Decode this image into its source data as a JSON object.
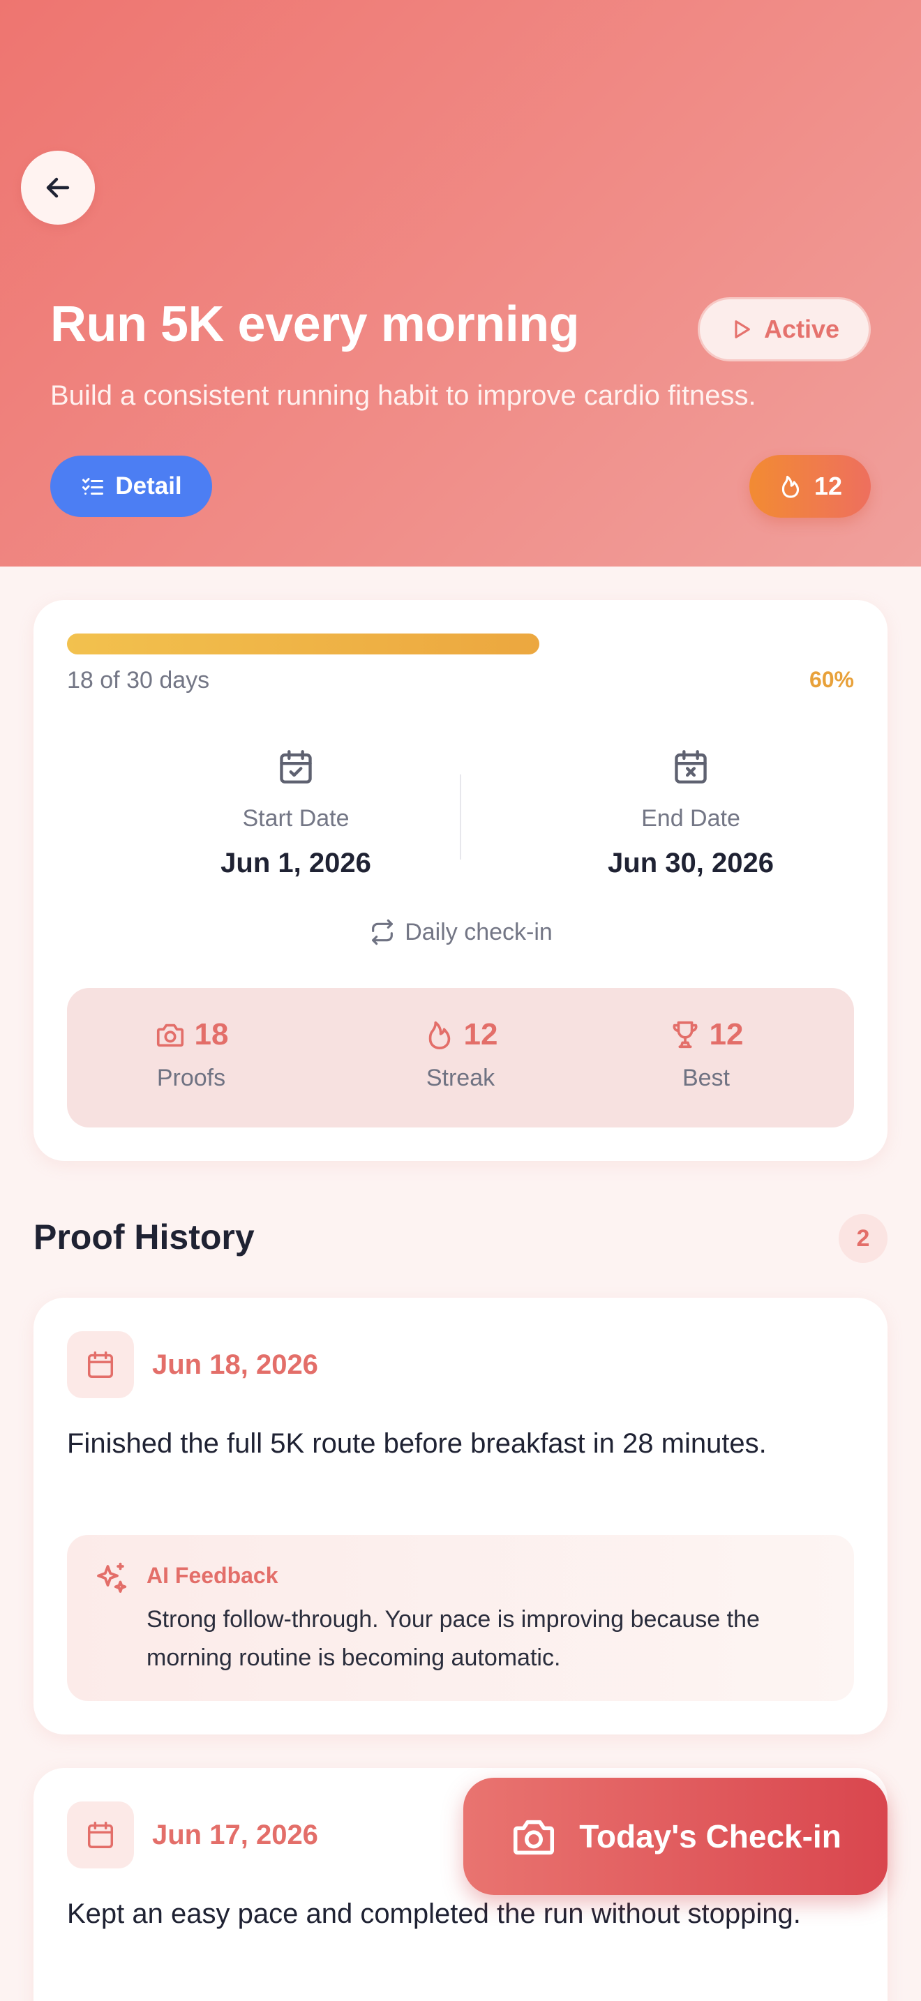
{
  "goal": {
    "title": "Run 5K every morning",
    "description": "Build a consistent running habit to improve cardio fitness.",
    "status": "Active",
    "detail_label": "Detail",
    "streak_badge": "12"
  },
  "progress": {
    "fraction": 0.6,
    "days_text": "18 of 30 days",
    "percent_text": "60%",
    "start_label": "Start Date",
    "start_value": "Jun 1, 2026",
    "end_label": "End Date",
    "end_value": "Jun 30, 2026",
    "frequency": "Daily check-in"
  },
  "stats": [
    {
      "value": "18",
      "label": "Proofs",
      "icon": "camera-icon"
    },
    {
      "value": "12",
      "label": "Streak",
      "icon": "flame-icon"
    },
    {
      "value": "12",
      "label": "Best",
      "icon": "trophy-icon"
    }
  ],
  "history": {
    "title": "Proof History",
    "count": "2",
    "entries": [
      {
        "date": "Jun 18, 2026",
        "text": "Finished the full 5K route before breakfast in 28 minutes.",
        "ai_label": "AI Feedback",
        "ai_text": "Strong follow-through. Your pace is improving because the morning routine is becoming automatic."
      },
      {
        "date": "Jun 17, 2026",
        "text": "Kept an easy pace and completed the run without stopping."
      }
    ]
  },
  "fab": {
    "label": "Today's Check-in"
  },
  "colors": {
    "header_start": "#EE7570",
    "accent_red": "#E36E69",
    "accent_blue": "#4C7EF3",
    "progress_yellow": "#ECA73F"
  }
}
